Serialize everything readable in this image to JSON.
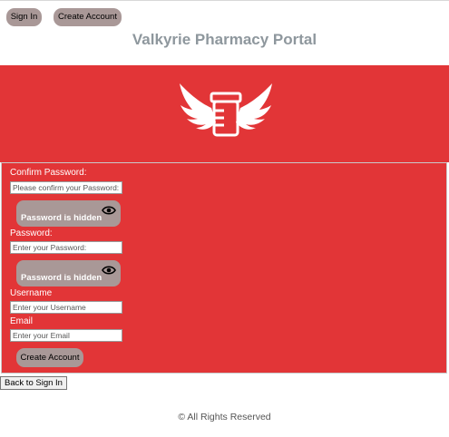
{
  "header": {
    "signin_label": "Sign In",
    "create_account_label": "Create Account",
    "title": "Valkyrie Pharmacy Portal"
  },
  "logo": {
    "icon": "winged-pill-bottle-icon"
  },
  "form": {
    "confirm_password": {
      "label": "Confirm Password:",
      "placeholder": "Please confirm your Password:",
      "toggle_label": "Password is hidden"
    },
    "password": {
      "label": "Password:",
      "placeholder": "Enter your Password:",
      "toggle_label": "Password is hidden"
    },
    "username": {
      "label": "Username",
      "placeholder": "Enter your Username"
    },
    "email": {
      "label": "Email",
      "placeholder": "Enter your Email"
    },
    "submit_label": "Create Account"
  },
  "back_label": "Back to Sign In",
  "footer": {
    "text": "© All Rights Reserved"
  },
  "colors": {
    "banner": "#e23537",
    "button": "#a99897",
    "title": "#8e979d"
  }
}
